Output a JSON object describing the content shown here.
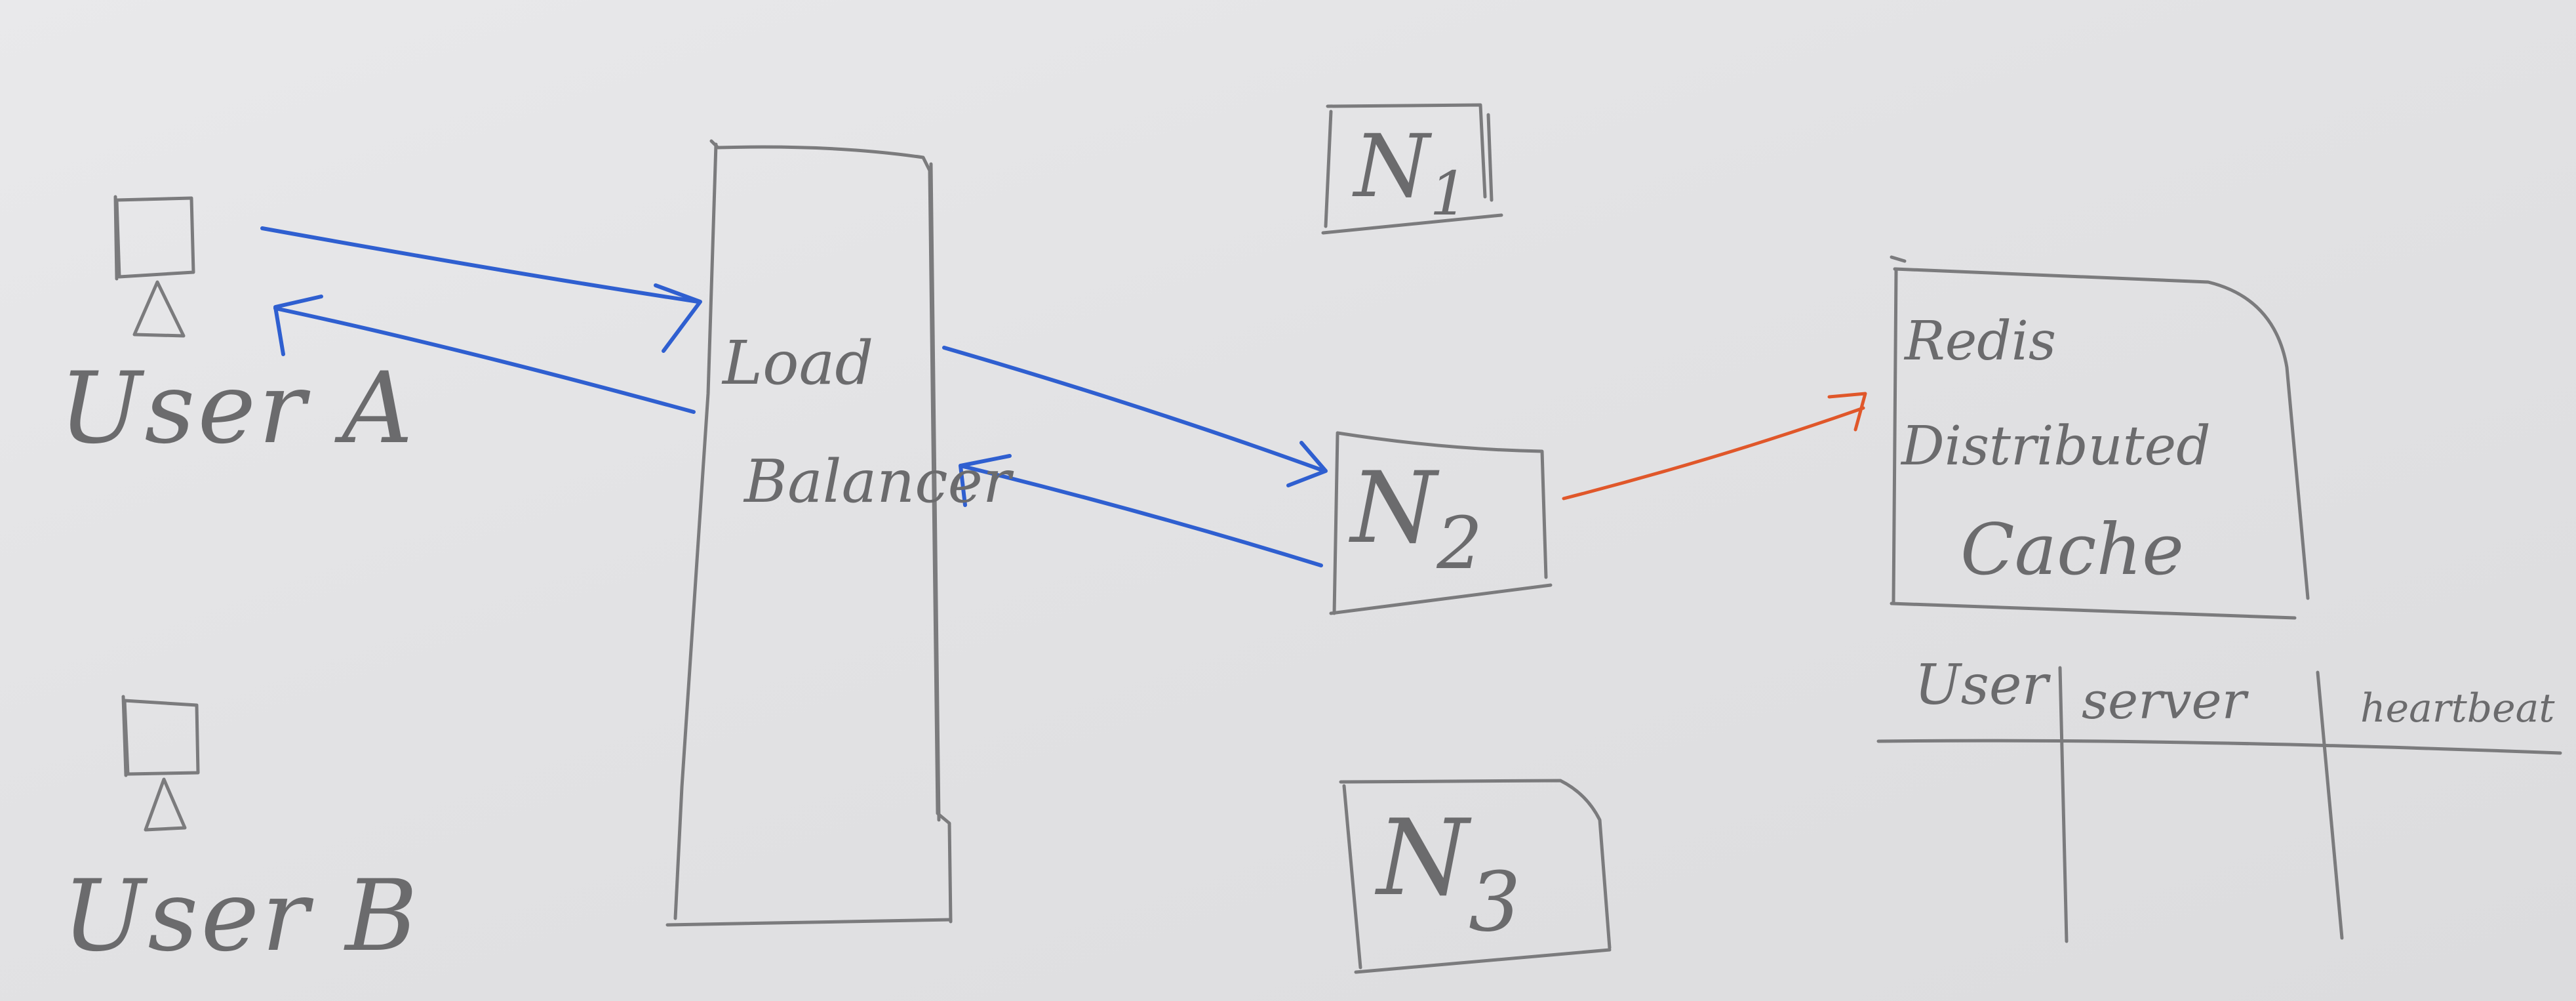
{
  "users": {
    "user_a": "User A",
    "user_b": "User B"
  },
  "load_balancer": {
    "line1": "Load",
    "line2": "Balancer"
  },
  "nodes": {
    "n1": "N",
    "n1_sub": "1",
    "n2": "N",
    "n2_sub": "2",
    "n3": "N",
    "n3_sub": "3"
  },
  "cache": {
    "line1": "Redis",
    "line2": "Distributed",
    "line3": "Cache"
  },
  "table": {
    "headers": [
      "User",
      "server",
      "heartbeat"
    ]
  },
  "colors": {
    "pencil": "#7b7b7d",
    "request_arrow": "#2f5fd0",
    "cache_arrow": "#e0572a"
  }
}
